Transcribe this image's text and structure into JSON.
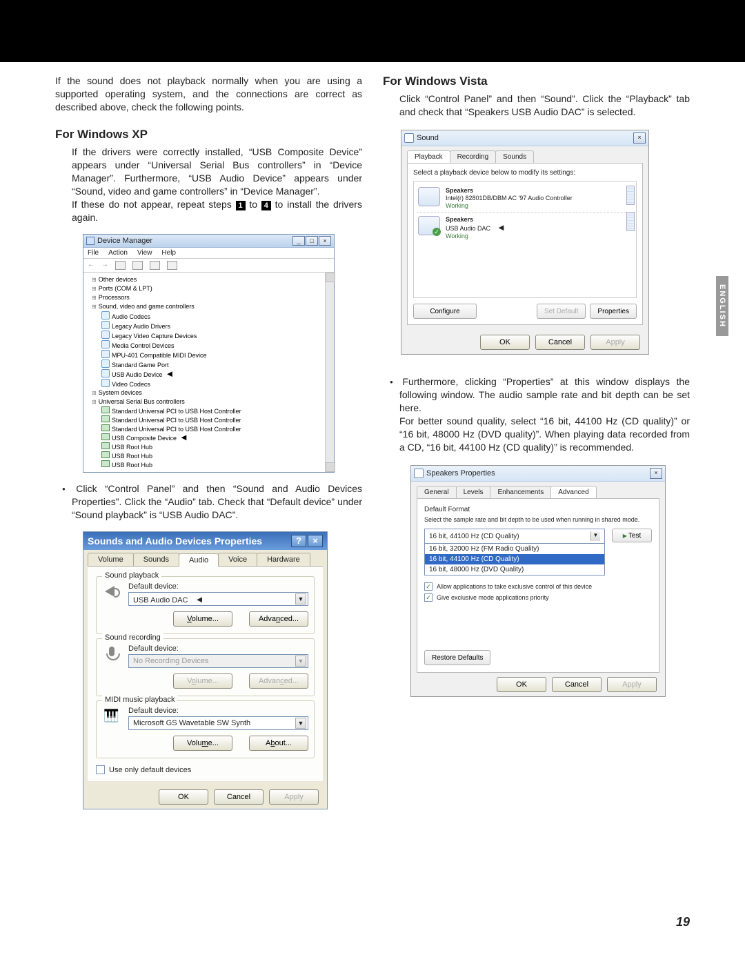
{
  "lang_tab": "ENGLISH",
  "page_number": "19",
  "intro": "If the sound does not playback normally when you are using a supported operating system, and the connections are correct as described above, check the following points.",
  "xp": {
    "heading": "For Windows XP",
    "para1": "If the drivers were correctly installed, “USB Composite Device” appears under “Universal Serial Bus controllers” in “Device Manager”. Furthermore, “USB Audio Device” appears under “Sound, video and game controllers” in “Device Manager”.",
    "para2_pre": "If these do not appear, repeat steps ",
    "step1": "1",
    "para2_mid": " to ",
    "step4": "4",
    "para2_post": " to install the drivers again.",
    "dm": {
      "title": "Device Manager",
      "menu": {
        "file": "File",
        "action": "Action",
        "view": "View",
        "help": "Help"
      },
      "tree": {
        "other": "Other devices",
        "ports": "Ports (COM & LPT)",
        "processors": "Processors",
        "svg": "Sound, video and game controllers",
        "svg_items": [
          "Audio Codecs",
          "Legacy Audio Drivers",
          "Legacy Video Capture Devices",
          "Media Control Devices",
          "MPU-401 Compatible MIDI Device",
          "Standard Game Port",
          "USB Audio Device",
          "Video Codecs"
        ],
        "system_devices": "System devices",
        "usb": "Universal Serial Bus controllers",
        "usb_items": [
          "Standard Universal PCI to USB Host Controller",
          "Standard Universal PCI to USB Host Controller",
          "Standard Universal PCI to USB Host Controller",
          "USB Composite Device",
          "USB Root Hub",
          "USB Root Hub",
          "USB Root Hub"
        ]
      }
    },
    "bullet2": "Click “Control Panel” and then “Sound and Audio Devices Properties”. Click the “Audio” tab. Check that “Default device” under “Sound playback” is “USB Audio DAC”.",
    "sad": {
      "title": "Sounds and Audio Devices Properties",
      "tabs": {
        "volume": "Volume",
        "sounds": "Sounds",
        "audio": "Audio",
        "voice": "Voice",
        "hardware": "Hardware"
      },
      "playback": {
        "title": "Sound playback",
        "label": "Default device:",
        "value": "USB Audio DAC",
        "volume": "Volume...",
        "advanced": "Advanced..."
      },
      "recording": {
        "title": "Sound recording",
        "label": "Default device:",
        "value": "No Recording Devices",
        "volume": "Volume...",
        "advanced": "Advanced..."
      },
      "midi": {
        "title": "MIDI music playback",
        "label": "Default device:",
        "value": "Microsoft GS Wavetable SW Synth",
        "volume": "Volume...",
        "about": "About..."
      },
      "use_default": "Use only default devices",
      "ok": "OK",
      "cancel": "Cancel",
      "apply": "Apply"
    }
  },
  "vista": {
    "heading": "For Windows Vista",
    "para1": "Click “Control Panel” and then “Sound”. Click the “Playback” tab and check that “Speakers USB Audio DAC” is selected.",
    "sound": {
      "title": "Sound",
      "tabs": {
        "playback": "Playback",
        "recording": "Recording",
        "sounds": "Sounds"
      },
      "note": "Select a playback device below to modify its settings:",
      "item1": {
        "name": "Speakers",
        "desc": "Intel(r) 82801DB/DBM AC '97 Audio Controller",
        "status": "Working"
      },
      "item2": {
        "name": "Speakers",
        "desc": "USB Audio DAC",
        "status": "Working"
      },
      "configure": "Configure",
      "set_default": "Set Default",
      "properties": "Properties",
      "ok": "OK",
      "cancel": "Cancel",
      "apply": "Apply"
    },
    "bullet2": "Furthermore, clicking “Properties” at this window displays the following window. The audio sample rate and bit depth can be set here.",
    "para3": "For better sound quality, select “16 bit, 44100 Hz (CD quality)” or “16 bit, 48000 Hz (DVD quality)”. When playing data recorded from a CD, “16 bit, 44100 Hz (CD quality)” is recommended.",
    "sp": {
      "title": "Speakers Properties",
      "tabs": {
        "general": "General",
        "levels": "Levels",
        "enhancements": "Enhancements",
        "advanced": "Advanced"
      },
      "df_title": "Default Format",
      "df_desc": "Select the sample rate and bit depth to be used when running in shared mode.",
      "combo_value": "16 bit, 44100 Hz (CD Quality)",
      "options": [
        "16 bit, 32000 Hz (FM Radio Quality)",
        "16 bit, 44100 Hz (CD Quality)",
        "16 bit, 48000 Hz (DVD Quality)"
      ],
      "test": "Test",
      "chk1": "Allow applications to take exclusive control of this device",
      "chk2": "Give exclusive mode applications priority",
      "restore": "Restore Defaults",
      "ok": "OK",
      "cancel": "Cancel",
      "apply": "Apply"
    }
  }
}
